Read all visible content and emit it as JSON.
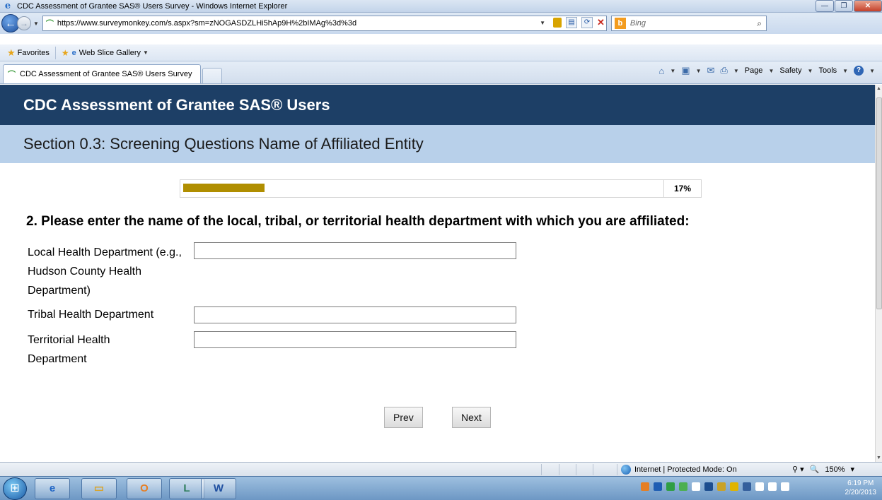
{
  "window": {
    "title": "CDC Assessment of Grantee SAS® Users Survey - Windows Internet Explorer",
    "url": "https://www.surveymonkey.com/s.aspx?sm=zNOGASDZLHi5hAp9H%2bIMAg%3d%3d",
    "search_placeholder": "Bing",
    "favorites_label": "Favorites",
    "web_slice_label": "Web Slice Gallery",
    "tab_title": "CDC Assessment of Grantee SAS® Users Survey",
    "command_bar": {
      "page": "Page",
      "safety": "Safety",
      "tools": "Tools"
    }
  },
  "survey": {
    "title": "CDC Assessment of Grantee SAS® Users",
    "section": "Section 0.3: Screening Questions Name of Affiliated Entity",
    "progress": {
      "percent": 17,
      "label": "17%"
    },
    "question": "2. Please enter the name of the local, tribal, or territorial health department with which you are affiliated:",
    "fields": [
      {
        "label": "Local Health Department (e.g., Hudson County Health Department)",
        "value": ""
      },
      {
        "label": "Tribal Health Department",
        "value": ""
      },
      {
        "label": "Territorial Health Department",
        "value": ""
      }
    ],
    "buttons": {
      "prev": "Prev",
      "next": "Next"
    }
  },
  "statusbar": {
    "zone": "Internet | Protected Mode: On",
    "zoom": "150%"
  },
  "taskbar": {
    "time": "6:19 PM",
    "date": "2/20/2013"
  }
}
